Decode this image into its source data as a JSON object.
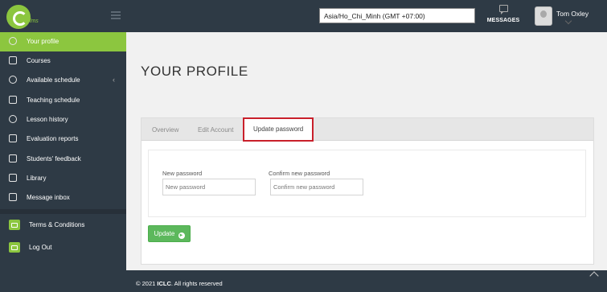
{
  "header": {
    "logo_text": "elms",
    "timezone_value": "Asia/Ho_Chi_Minh (GMT +07:00)",
    "messages_label": "MESSAGES",
    "user_name": "Tom Oxley"
  },
  "sidebar": {
    "items": [
      {
        "label": "Your profile",
        "icon": "user-icon",
        "active": true
      },
      {
        "label": "Courses",
        "icon": "book-icon"
      },
      {
        "label": "Available schedule",
        "icon": "clock-icon"
      },
      {
        "label": "Teaching schedule",
        "icon": "calendar-icon"
      },
      {
        "label": "Lesson history",
        "icon": "clock-icon"
      },
      {
        "label": "Evaluation reports",
        "icon": "document-icon"
      },
      {
        "label": "Students' feedback",
        "icon": "document-icon"
      },
      {
        "label": "Library",
        "icon": "open-book-icon"
      },
      {
        "label": "Message inbox",
        "icon": "chat-icon"
      }
    ],
    "bottom_items": [
      {
        "label": "Terms & Conditions",
        "icon": "terminal-icon"
      },
      {
        "label": "Log Out",
        "icon": "logout-icon"
      }
    ],
    "accent_color": "#8cc63f"
  },
  "main": {
    "page_title": "YOUR PROFILE",
    "tabs": [
      {
        "label": "Overview"
      },
      {
        "label": "Edit Account"
      },
      {
        "label": "Update password",
        "active": true
      }
    ],
    "form": {
      "new_password_label": "New password",
      "new_password_placeholder": "New password",
      "confirm_password_label": "Confirm new password",
      "confirm_password_placeholder": "Confirm new password"
    },
    "update_button_label": "Update"
  },
  "footer": {
    "copyright_prefix": "© 2021",
    "brand": "ICLC",
    "copyright_suffix": ". All rights reserved"
  }
}
